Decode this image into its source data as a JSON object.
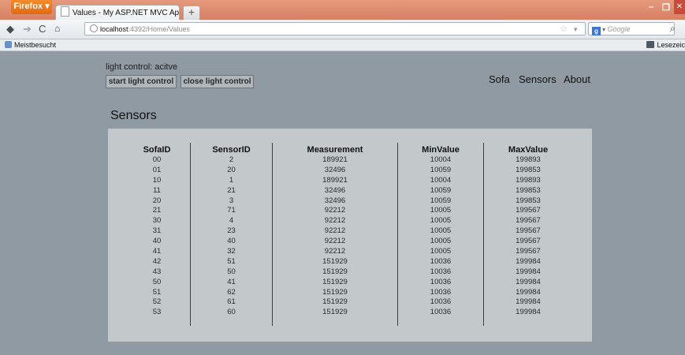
{
  "browser": {
    "menu_button": "Firefox",
    "tab_title": "Values - My ASP.NET MVC Application",
    "new_tab": "+",
    "url_host": "localhost",
    "url_rest": ":4392/Home/Values",
    "search_engine": "Google",
    "bookmark_left": "Meistbesucht",
    "bookmark_right": "Lesezeic"
  },
  "page": {
    "light_status": "light control: acitve",
    "start_button": "start light control",
    "close_button": "close light control",
    "nav": [
      "Sofa",
      "Sensors",
      "About"
    ],
    "title": "Sensors"
  },
  "table": {
    "headers": [
      "SofaID",
      "SensorID",
      "Measurement",
      "MinValue",
      "MaxValue"
    ],
    "columns": [
      [
        "00",
        "01",
        "10",
        "11",
        "20",
        "21",
        "30",
        "31",
        "40",
        "41",
        "42",
        "43",
        "50",
        "51",
        "52",
        "53"
      ],
      [
        "2",
        "20",
        "1",
        "21",
        "3",
        "71",
        "4",
        "23",
        "40",
        "32",
        "51",
        "50",
        "41",
        "62",
        "61",
        "60"
      ],
      [
        "189921",
        "32496",
        "189921",
        "32496",
        "32496",
        "92212",
        "92212",
        "92212",
        "92212",
        "92212",
        "151929",
        "151929",
        "151929",
        "151929",
        "151929",
        "151929"
      ],
      [
        "10004",
        "10059",
        "10004",
        "10059",
        "10059",
        "10005",
        "10005",
        "10005",
        "10005",
        "10005",
        "10036",
        "10036",
        "10036",
        "10036",
        "10036",
        "10036"
      ],
      [
        "199893",
        "199853",
        "199893",
        "199853",
        "199853",
        "199567",
        "199567",
        "199567",
        "199567",
        "199567",
        "199984",
        "199984",
        "199984",
        "199984",
        "199984",
        "199984"
      ]
    ]
  }
}
